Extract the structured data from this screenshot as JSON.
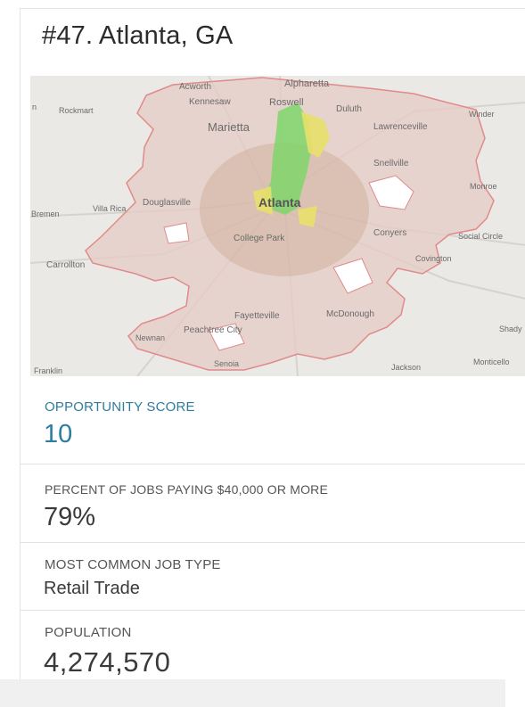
{
  "header": {
    "title": "#47. Atlanta, GA"
  },
  "map": {
    "center_label": "Atlanta",
    "labels": {
      "acworth": "Acworth",
      "alpharetta": "Alpharetta",
      "kennesaw": "Kennesaw",
      "roswell": "Roswell",
      "duluth": "Duluth",
      "rockmart": "Rockmart",
      "marietta": "Marietta",
      "lawrenceville": "Lawrenceville",
      "winder": "Winder",
      "snellville": "Snellville",
      "monroe": "Monroe",
      "bremen": "Bremen",
      "villa_rica": "Villa Rica",
      "douglasville": "Douglasville",
      "college_park": "College Park",
      "conyers": "Conyers",
      "social_circle": "Social Circle",
      "covington": "Covington",
      "carrollton": "Carrollton",
      "fayetteville": "Fayetteville",
      "mcdonough": "McDonough",
      "newnan": "Newnan",
      "peachtree_city": "Peachtree City",
      "shady": "Shady",
      "franklin": "Franklin",
      "senoia": "Senoia",
      "jackson": "Jackson",
      "monticello": "Monticello",
      "edge_n": "n"
    }
  },
  "stats": {
    "opportunity": {
      "label": "OPPORTUNITY SCORE",
      "value": "10"
    },
    "jobs_40k": {
      "label": "PERCENT OF JOBS PAYING $40,000 OR MORE",
      "value": "79%"
    },
    "job_type": {
      "label": "MOST COMMON JOB TYPE",
      "value": "Retail Trade"
    },
    "population": {
      "label": "POPULATION",
      "value": "4,274,570"
    }
  },
  "colors": {
    "accent": "#2e7d9e",
    "metro_fill": "#e9cfc9",
    "metro_outline": "#e08a8a",
    "heat_green": "#7fd66b",
    "heat_yellow": "#e8e06a"
  }
}
